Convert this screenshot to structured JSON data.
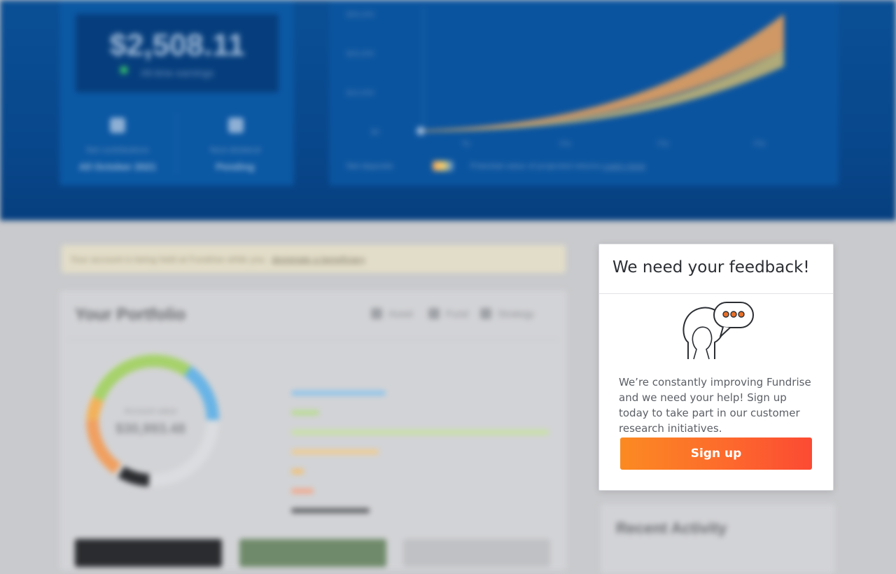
{
  "background": {
    "hero": {
      "balance": "$2,508.11",
      "balance_sub": "All-time earnings",
      "stat_left_label": "Net contributions",
      "stat_left_value": "All October 2021",
      "stat_right_label": "Next dividend",
      "stat_right_value": "Pending"
    },
    "chart": {
      "y_ticks": [
        "$30,000",
        "$20,000",
        "$10,000",
        "$0"
      ],
      "x_ticks": [
        "5y",
        "10y",
        "15y",
        "20y"
      ],
      "legend_left": "Net deposits",
      "legend_right": "Potential value of projected returns",
      "legend_link": "Learn more"
    },
    "notice": {
      "text": "Your account is being held at Fundrise while you",
      "link": "designate a beneficiary"
    },
    "portfolio": {
      "title": "Your Portfolio",
      "tabs": [
        "Asset",
        "Fund",
        "Strategy"
      ],
      "donut_label": "Account value",
      "donut_value": "$30,993.48"
    },
    "recent_activity_title": "Recent Activity"
  },
  "modal": {
    "title": "We need your feedback!",
    "body": "We’re constantly improving Fundrise and we need your help! Sign up today to take part in our customer research initiatives.",
    "button_label": "Sign up",
    "illustration_icon": "chat-bubble-person-icon",
    "colors": {
      "button_start": "#fb8a22",
      "button_end": "#fc4a33",
      "dots": "#e8702a"
    }
  }
}
